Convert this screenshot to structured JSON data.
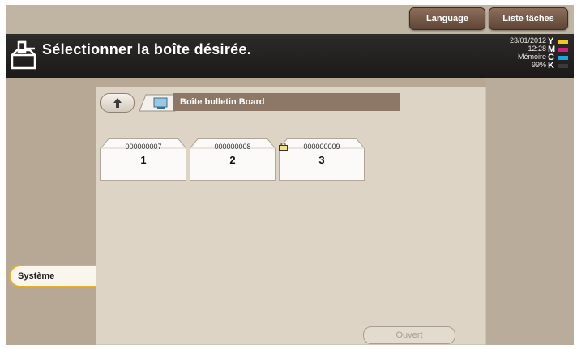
{
  "topbar": {
    "language_label": "Language",
    "jobs_label": "Liste tâches"
  },
  "header": {
    "title": "Sélectionner la boîte désirée.",
    "date": "23/01/2012",
    "time": "12:28",
    "memory_label": "Mémoire",
    "memory_value": "99%",
    "toner": [
      {
        "letter": "Y",
        "color": "#f2c81a"
      },
      {
        "letter": "M",
        "color": "#d11f7a"
      },
      {
        "letter": "C",
        "color": "#1aa3e0"
      },
      {
        "letter": "K",
        "color": "#3a3a3a"
      }
    ]
  },
  "sidebar": {
    "system_tab": "Système"
  },
  "main": {
    "path": "Boîte bulletin Board",
    "boxes": [
      {
        "id": "000000007",
        "number": "1",
        "locked": false
      },
      {
        "id": "000000008",
        "number": "2",
        "locked": false
      },
      {
        "id": "000000009",
        "number": "3",
        "locked": true
      }
    ],
    "open_label": "Ouvert"
  }
}
